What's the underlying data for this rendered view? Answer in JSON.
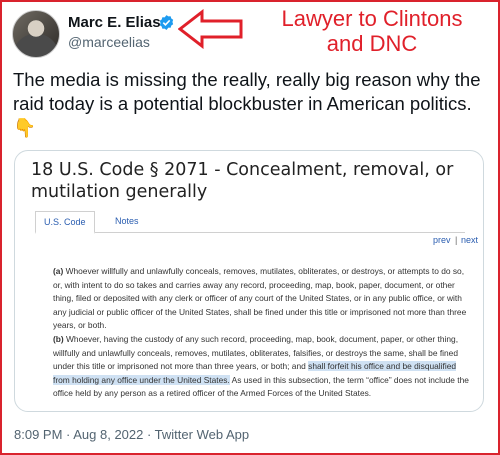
{
  "author": {
    "name": "Marc E. Elias",
    "handle": "@marceelias"
  },
  "annotation": {
    "line1": "Lawyer to Clintons",
    "line2": "and DNC",
    "color": "#e0202a"
  },
  "tweet": {
    "text": "The media is missing the really, really big reason why the raid today is a potential blockbuster in American politics.👇"
  },
  "card": {
    "title": "18 U.S. Code § 2071 - Concealment, removal, or mutilation generally",
    "tabs": [
      "U.S. Code",
      "Notes"
    ],
    "pager": {
      "prev": "prev",
      "sep": "|",
      "next": "next"
    },
    "para_a": {
      "marker": "(a)",
      "text": " Whoever willfully and unlawfully conceals, removes, mutilates, obliterates, or destroys, or attempts to do so, or, with intent to do so takes and carries away any record, proceeding, map, book, paper, document, or other thing, filed or deposited with any clerk or officer of any court of the United States, or in any public office, or with any judicial or public officer of the United States, shall be fined under this title or imprisoned not more than three years, or both."
    },
    "para_b": {
      "marker": "(b)",
      "text_before": " Whoever, having the custody of any such record, proceeding, map, book, document, paper, or other thing, willfully and unlawfully conceals, removes, mutilates, obliterates, falsifies, or destroys the same, shall be fined under this title or imprisoned not more than three years, or both; and ",
      "highlight": "shall forfeit his office and be disqualified from holding any office under the United States.",
      "text_after": " As used in this subsection, the term “office” does not include the office held by any person as a retired officer of the Armed Forces of the United States."
    }
  },
  "meta": {
    "timestamp": "8:09 PM · Aug 8, 2022 · Twitter Web App"
  },
  "colors": {
    "frame": "#d9232d",
    "verified": "#1d9bf0",
    "link": "#2a5db0",
    "highlight": "#cfe1f3"
  }
}
